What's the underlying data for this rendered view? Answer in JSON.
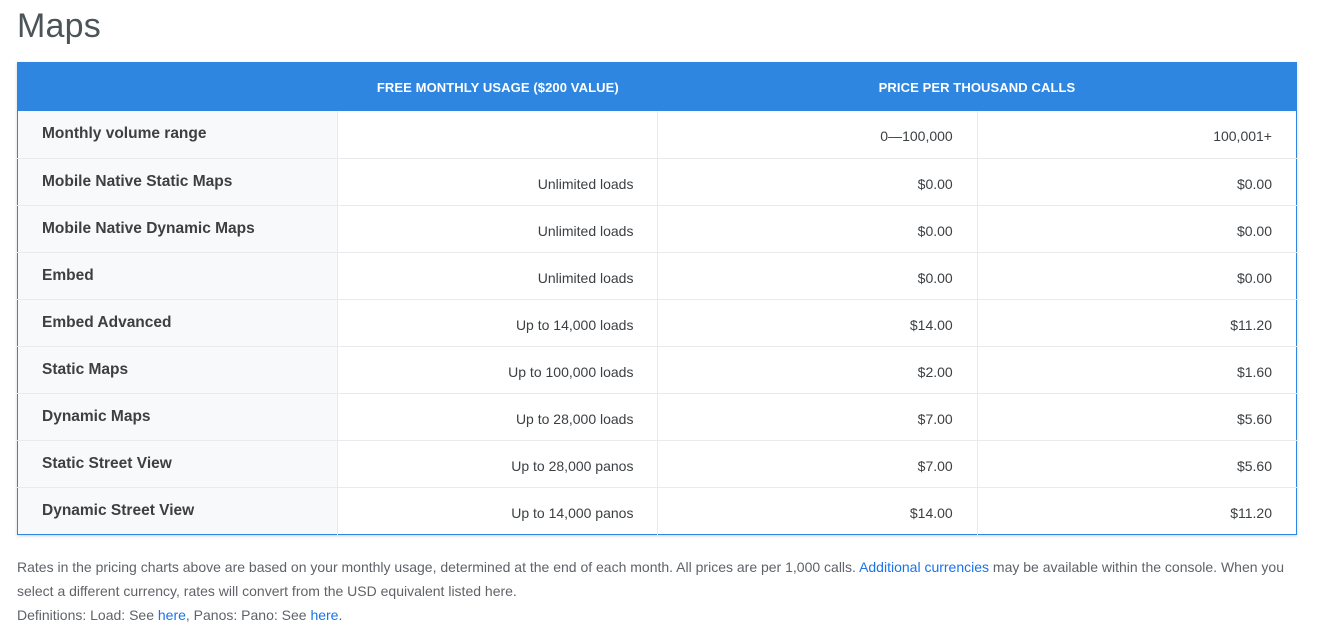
{
  "page": {
    "title": "Maps"
  },
  "table": {
    "headers": [
      "",
      "FREE MONTHLY USAGE ($200 VALUE)",
      "PRICE PER THOUSAND CALLS",
      ""
    ],
    "rows": [
      {
        "label": "Monthly volume range",
        "free": "",
        "tier1": "0—100,000",
        "tier2": "100,001+"
      },
      {
        "label": "Mobile Native Static Maps",
        "free": "Unlimited loads",
        "tier1": "$0.00",
        "tier2": "$0.00"
      },
      {
        "label": "Mobile Native Dynamic Maps",
        "free": "Unlimited loads",
        "tier1": "$0.00",
        "tier2": "$0.00"
      },
      {
        "label": "Embed",
        "free": "Unlimited loads",
        "tier1": "$0.00",
        "tier2": "$0.00"
      },
      {
        "label": "Embed Advanced",
        "free": "Up to 14,000 loads",
        "tier1": "$14.00",
        "tier2": "$11.20"
      },
      {
        "label": "Static Maps",
        "free": "Up to 100,000 loads",
        "tier1": "$2.00",
        "tier2": "$1.60"
      },
      {
        "label": "Dynamic Maps",
        "free": "Up to 28,000 loads",
        "tier1": "$7.00",
        "tier2": "$5.60"
      },
      {
        "label": "Static Street View",
        "free": "Up to 28,000 panos",
        "tier1": "$7.00",
        "tier2": "$5.60"
      },
      {
        "label": "Dynamic Street View",
        "free": "Up to 14,000 panos",
        "tier1": "$14.00",
        "tier2": "$11.20"
      }
    ]
  },
  "footnote": {
    "line1_before": "Rates in the pricing charts above are based on your monthly usage, determined at the end of each month. All prices are per 1,000 calls. ",
    "line1_link": "Additional currencies",
    "line1_after": " may be available within the console. When you select a different currency, rates will convert from the USD equivalent listed here.",
    "defs_prefix": "Definitions: Load: See ",
    "defs_link1": "here",
    "defs_middle": ", Panos: Pano: See ",
    "defs_link2": "here",
    "defs_suffix": "."
  },
  "colors": {
    "header_bg": "#2f86e0",
    "link": "#1a73e8",
    "label_bg": "#f8f9fa"
  }
}
